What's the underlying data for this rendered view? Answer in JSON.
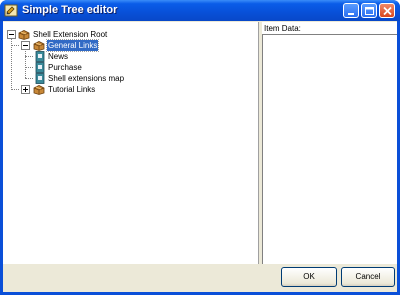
{
  "window": {
    "title": "Simple Tree editor"
  },
  "tree": {
    "nodes": [
      {
        "label": "Shell Extension Root",
        "icon": "package-icon"
      },
      {
        "label": "General Links",
        "icon": "package-icon"
      },
      {
        "label": "News",
        "icon": "document-icon"
      },
      {
        "label": "Purchase",
        "icon": "document-icon"
      },
      {
        "label": "Shell extensions map",
        "icon": "document-icon"
      },
      {
        "label": "Tutorial Links",
        "icon": "package-icon"
      }
    ]
  },
  "item_data": {
    "label": "Item Data:",
    "value": ""
  },
  "buttons": {
    "ok": "OK",
    "cancel": "Cancel"
  },
  "colors": {
    "titlebar": "#0a4fd8",
    "selection": "#316ac5",
    "face": "#ece9d8"
  }
}
